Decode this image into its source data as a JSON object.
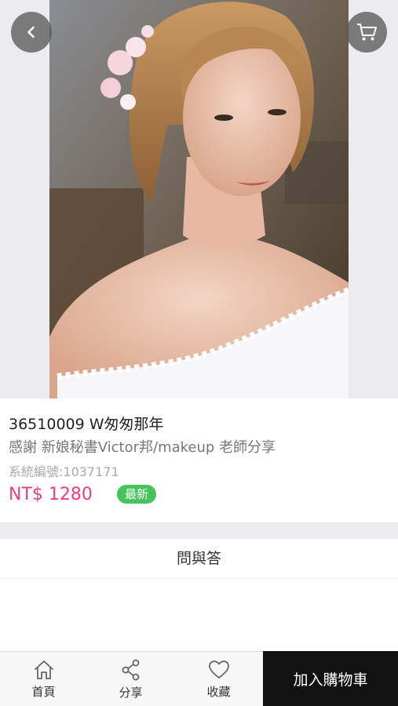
{
  "nav": {
    "back_icon": "chevron-left-icon",
    "cart_icon": "shopping-cart-icon"
  },
  "hero": {
    "image_description": "bride with floral hair accessory",
    "dots": 2
  },
  "product": {
    "title": "36510009 W匆匆那年",
    "subtitle": "感謝 新娘秘書Victor邦/makeup 老師分享",
    "system_no": "系統編號:1037171",
    "price": "NT$ 1280",
    "badge": "最新",
    "price_color": "#ea3f7e",
    "badge_color": "#46c35a"
  },
  "qa": {
    "label": "問與答"
  },
  "bottom_bar": {
    "home_label": "首頁",
    "share_label": "分享",
    "favorite_label": "收藏",
    "add_to_cart_label": "加入購物車"
  }
}
